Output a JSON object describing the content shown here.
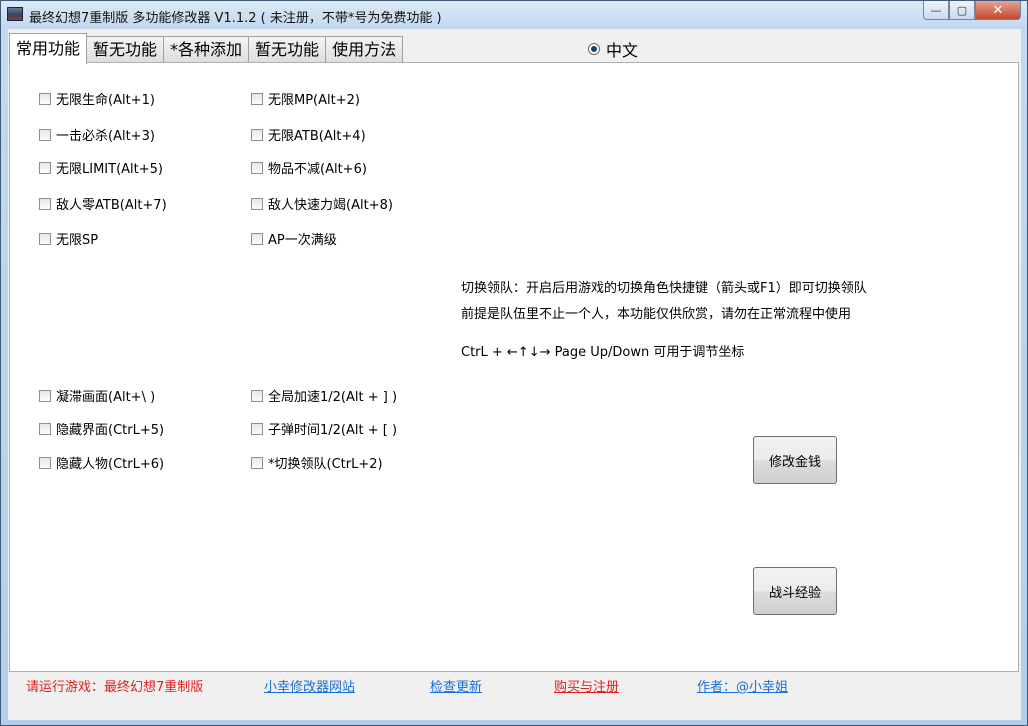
{
  "window": {
    "title": "最终幻想7重制版 多功能修改器  V1.1.2 ( 未注册，不带*号为免费功能 )",
    "min_glyph": "—",
    "max_glyph": "▢",
    "close_glyph": "✕"
  },
  "tabs": [
    {
      "label": "常用功能",
      "active": true
    },
    {
      "label": "暂无功能",
      "active": false
    },
    {
      "label": "*各种添加",
      "active": false
    },
    {
      "label": "暂无功能",
      "active": false
    },
    {
      "label": "使用方法",
      "active": false
    }
  ],
  "language": {
    "label": "中文",
    "selected": true
  },
  "checkboxes": {
    "infinite_hp": "无限生命(Alt+1)",
    "infinite_mp": "无限MP(Alt+2)",
    "one_hit_kill": "一击必杀(Alt+3)",
    "infinite_atb": "无限ATB(Alt+4)",
    "infinite_limit": "无限LIMIT(Alt+5)",
    "items_no_decrease": "物品不减(Alt+6)",
    "enemy_zero_atb": "敌人零ATB(Alt+7)",
    "enemy_fast_exhaust": "敌人快速力竭(Alt+8)",
    "infinite_sp": "无限SP",
    "ap_max_once": "AP一次满级",
    "freeze_screen": "凝滞画面(Alt+\\ )",
    "global_speed": "全局加速1/2(Alt + ] )",
    "hide_ui": "隐藏界面(CtrL+5)",
    "bullet_time": "子弹时间1/2(Alt + [ )",
    "hide_character": "隐藏人物(CtrL+6)",
    "switch_leader": "*切换领队(CtrL+2)"
  },
  "info": {
    "line1": "切换领队：开启后用游戏的切换角色快捷键（箭头或F1）即可切换领队",
    "line2": "前提是队伍里不止一个人，本功能仅供欣赏，请勿在正常流程中使用",
    "line3": "CtrL + ←↑↓→  Page Up/Down 可用于调节坐标"
  },
  "buttons": {
    "modify_money": "修改金钱",
    "battle_exp": "战斗经验"
  },
  "footer": {
    "status": "请运行游戏：最终幻想7重制版",
    "website": "小幸修改器网站",
    "check_update": "检查更新",
    "buy_register": "购买与注册",
    "author": "作者：@小幸姐"
  }
}
